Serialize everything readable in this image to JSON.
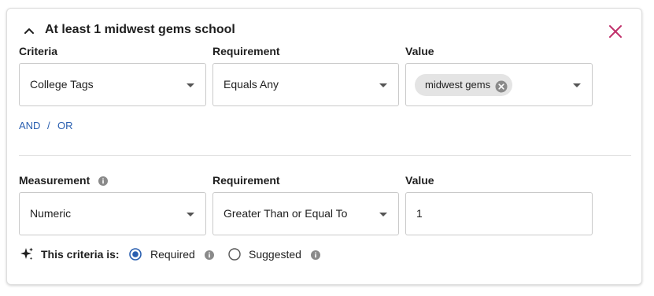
{
  "header": {
    "title": "At least 1 midwest gems school"
  },
  "row1": {
    "criteria_label": "Criteria",
    "criteria_value": "College Tags",
    "requirement_label": "Requirement",
    "requirement_value": "Equals Any",
    "value_label": "Value",
    "value_chip": "midwest gems"
  },
  "logic": {
    "and_label": "AND",
    "separator": "/",
    "or_label": "OR"
  },
  "row2": {
    "measurement_label": "Measurement",
    "measurement_value": "Numeric",
    "requirement_label": "Requirement",
    "requirement_value": "Greater Than or Equal To",
    "value_label": "Value",
    "value_input": "1"
  },
  "criteria_type": {
    "label": "This criteria is:",
    "options": [
      "Required",
      "Suggested"
    ],
    "selected": "Required"
  },
  "colors": {
    "close_icon": "#c0306a",
    "link": "#2a5fb0",
    "radio_selected": "#2a5fb0"
  }
}
